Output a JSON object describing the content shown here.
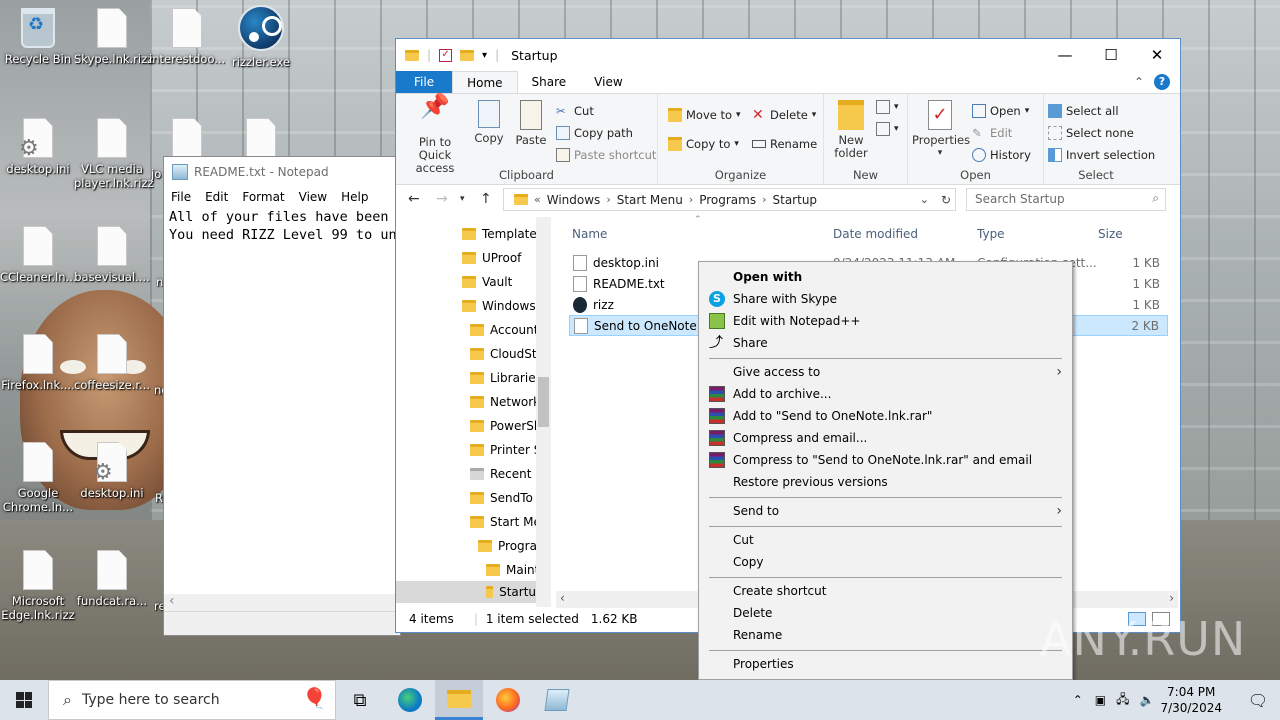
{
  "desktop": {
    "icons": [
      {
        "label": "Recycle Bin"
      },
      {
        "label": "Skype.lnk.rizz"
      },
      {
        "label": "interestdoo..."
      },
      {
        "label": "rizzler.exe"
      },
      {
        "label": "desktop.ini"
      },
      {
        "label": "VLC media player.lnk.rizz"
      },
      {
        "label": "CCleaner.ln..."
      },
      {
        "label": "basevisual...."
      },
      {
        "label": "Firefox.lnk...."
      },
      {
        "label": "coffeesize.r..."
      },
      {
        "label": "Google Chrome.ln..."
      },
      {
        "label": "desktop.ini"
      },
      {
        "label": "Microsoft Edge.lnk.rizz"
      },
      {
        "label": "fundcat.ra..."
      },
      {
        "label": "jo"
      },
      {
        "label": "ne"
      },
      {
        "label": "R"
      },
      {
        "label": "re"
      },
      {
        "label": "n"
      }
    ]
  },
  "notepad": {
    "title": "README.txt - Notepad",
    "menu": [
      "File",
      "Edit",
      "Format",
      "View",
      "Help"
    ],
    "lines": [
      "All of your files have been e",
      "You need RIZZ Level 99 to unl"
    ]
  },
  "explorer": {
    "title": "Startup",
    "tabs": [
      "File",
      "Home",
      "Share",
      "View"
    ],
    "clipboard": {
      "pin": "Pin to Quick access",
      "copy": "Copy",
      "paste": "Paste",
      "cut": "Cut",
      "copy_path": "Copy path",
      "paste_shortcut": "Paste shortcut",
      "label": "Clipboard"
    },
    "organize": {
      "move_to": "Move to",
      "copy_to": "Copy to",
      "delete": "Delete",
      "rename": "Rename",
      "label": "Organize"
    },
    "new": {
      "new_folder": "New folder",
      "label": "New"
    },
    "open": {
      "properties": "Properties",
      "open": "Open",
      "edit": "Edit",
      "history": "History",
      "label": "Open"
    },
    "select": {
      "select_all": "Select all",
      "select_none": "Select none",
      "invert": "Invert selection",
      "label": "Select"
    },
    "address": {
      "overflow": "«",
      "segments": [
        "Windows",
        "Start Menu",
        "Programs",
        "Startup"
      ]
    },
    "search_placeholder": "Search Startup",
    "nav": [
      "Templates",
      "UProof",
      "Vault",
      "Windows",
      "Account",
      "CloudSto",
      "Libraries",
      "Network",
      "PowerSh",
      "Printer Sh",
      "Recent It",
      "SendTo",
      "Start Men",
      "Program",
      "Maint",
      "Startu"
    ],
    "columns": {
      "name": "Name",
      "date": "Date modified",
      "type": "Type",
      "size": "Size"
    },
    "files": [
      {
        "name": "desktop.ini",
        "date": "9/24/2023 11:13 AM",
        "type": "Configuration sett...",
        "size": "1 KB"
      },
      {
        "name": "README.txt",
        "date": "",
        "type": "",
        "size": "1 KB"
      },
      {
        "name": "rizz",
        "date": "",
        "type": "",
        "size": "1 KB"
      },
      {
        "name": "Send to OneNote.lnk",
        "date": "",
        "type": "",
        "size": "2 KB"
      }
    ],
    "status": {
      "items": "4 items",
      "selected": "1 item selected",
      "size": "1.62 KB"
    }
  },
  "context_menu": {
    "open_with": "Open with",
    "share_skype": "Share with Skype",
    "edit_notepadpp": "Edit with Notepad++",
    "share": "Share",
    "give_access": "Give access to",
    "add_archive": "Add to archive...",
    "add_rar": "Add to \"Send to OneNote.lnk.rar\"",
    "compress_email": "Compress and email...",
    "compress_rar_email": "Compress to \"Send to OneNote.lnk.rar\" and email",
    "restore": "Restore previous versions",
    "send_to": "Send to",
    "cut": "Cut",
    "copy": "Copy",
    "create_shortcut": "Create shortcut",
    "delete": "Delete",
    "rename": "Rename",
    "properties": "Properties"
  },
  "watermark": "ANY.RUN",
  "taskbar": {
    "search_placeholder": "Type here to search",
    "time": "7:04 PM",
    "date": "7/30/2024"
  }
}
